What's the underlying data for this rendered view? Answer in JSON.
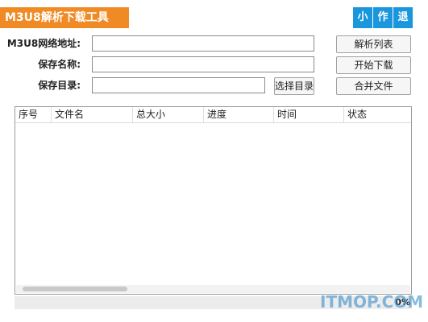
{
  "app": {
    "title": "M3U8解析下载工具"
  },
  "window_buttons": {
    "minimize": "小",
    "about": "作",
    "exit": "退"
  },
  "form": {
    "url_label": "M3U8网络地址:",
    "url_value": "",
    "name_label": "保存名称:",
    "name_value": "",
    "dir_label": "保存目录:",
    "dir_value": ""
  },
  "buttons": {
    "parse_list": "解析列表",
    "start_download": "开始下载",
    "merge_files": "合并文件",
    "choose_dir": "选择目录"
  },
  "table": {
    "columns": [
      "序号",
      "文件名",
      "总大小",
      "进度",
      "时间",
      "状态"
    ],
    "rows": []
  },
  "status": {
    "progress_percent": "0%"
  },
  "watermark": "ITMOP.COM"
}
